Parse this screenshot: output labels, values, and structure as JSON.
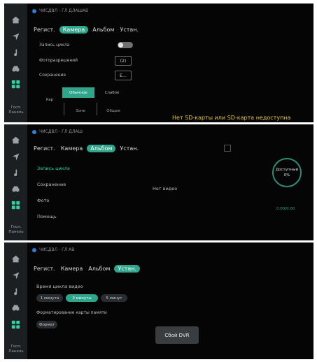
{
  "sidebar": {
    "label": "Госп. Панель",
    "icons": [
      "home-icon",
      "navigation-icon",
      "music-icon",
      "car-icon",
      "apps-icon"
    ]
  },
  "status_text": "ЧИСДВЛ - ГЛ ДЛАШАВ",
  "panel1": {
    "tabs": [
      "Регист.",
      "Камера",
      "Альбом",
      "Устан."
    ],
    "active_tab": "Камера",
    "rows": {
      "loop_record": "Запись цикла",
      "photo_resolution": "Фоторазрешений",
      "save": "Сохранение",
      "resolution_value": "(2)",
      "save_icon_text": "E…"
    },
    "segment": {
      "left_label": "Кар",
      "row1": [
        "Обычное",
        "Слабое"
      ],
      "row2": [
        "Зоне",
        "Общее"
      ]
    },
    "warning": "Нет SD-карты или SD-карта недоступна"
  },
  "panel2": {
    "tabs": [
      "Регист.",
      "Камера",
      "Альбом",
      "Устан."
    ],
    "active_tab": "Альбом",
    "status_text": "ЧИСДВЛ - ГЛ ДЛАШ",
    "items": [
      "Запись цикла",
      "Сохранение",
      "Фото",
      "Помощь"
    ],
    "active_item": "Запись цикла",
    "empty": "Нет видео",
    "gauge_label": "Доступный",
    "gauge_value": "0%",
    "gauge_sub": "0.00/0.00"
  },
  "panel3": {
    "tabs": [
      "Регист.",
      "Камера",
      "Альбом",
      "Устан."
    ],
    "active_tab": "Устан.",
    "status_text": "ЧИСДВЛ - ГЛ АВ",
    "loop_time_label": "Время цикла видео",
    "options": [
      "1 минута",
      "3 минуты",
      "5 минут"
    ],
    "active_option": "3 минуты",
    "format_label": "Форматирование карты памяти",
    "format_button": "Формат",
    "toast": "Сбой DVR"
  },
  "colors": {
    "accent": "#2fa58b",
    "warning": "#e8c43a",
    "sidebar": "#1c1f22",
    "background": "#050505"
  }
}
